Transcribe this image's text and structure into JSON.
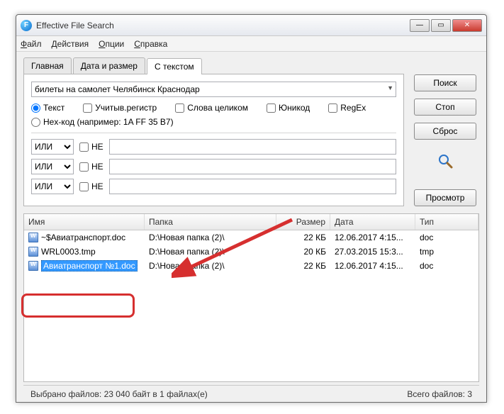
{
  "window": {
    "title": "Effective File Search"
  },
  "menu": {
    "file": "Файл",
    "actions": "Действия",
    "options": "Опции",
    "help": "Справка"
  },
  "tabs": {
    "main": "Главная",
    "date": "Дата и размер",
    "text": "С текстом"
  },
  "search": {
    "query": "билеты на самолет Челябинск Краснодар"
  },
  "options": {
    "text": "Текст",
    "case": "Учитыв.регистр",
    "whole": "Слова целиком",
    "unicode": "Юникод",
    "regex": "RegEx",
    "hex": "Hex-код (например: 1A FF 35 B7)"
  },
  "logic": {
    "or": "ИЛИ",
    "not": "НЕ"
  },
  "buttons": {
    "search": "Поиск",
    "stop": "Стоп",
    "reset": "Сброс",
    "view": "Просмотр"
  },
  "cols": {
    "name": "Имя",
    "folder": "Папка",
    "size": "Размер",
    "date": "Дата",
    "type": "Тип"
  },
  "rows": [
    {
      "name": "~$Авиатранспорт.doc",
      "folder": "D:\\Новая папка (2)\\",
      "size": "22 КБ",
      "date": "12.06.2017 4:15...",
      "type": "doc"
    },
    {
      "name": "WRL0003.tmp",
      "folder": "D:\\Новая папка (2)\\",
      "size": "20 КБ",
      "date": "27.03.2015 15:3...",
      "type": "tmp"
    },
    {
      "name": "Авиатранспорт №1.doc",
      "folder": "D:\\Новая папка (2)\\",
      "size": "22 КБ",
      "date": "12.06.2017 4:15...",
      "type": "doc"
    }
  ],
  "status": {
    "left": "Выбрано файлов: 23 040 байт  в 1 файлах(е)",
    "right": "Всего файлов: 3"
  }
}
